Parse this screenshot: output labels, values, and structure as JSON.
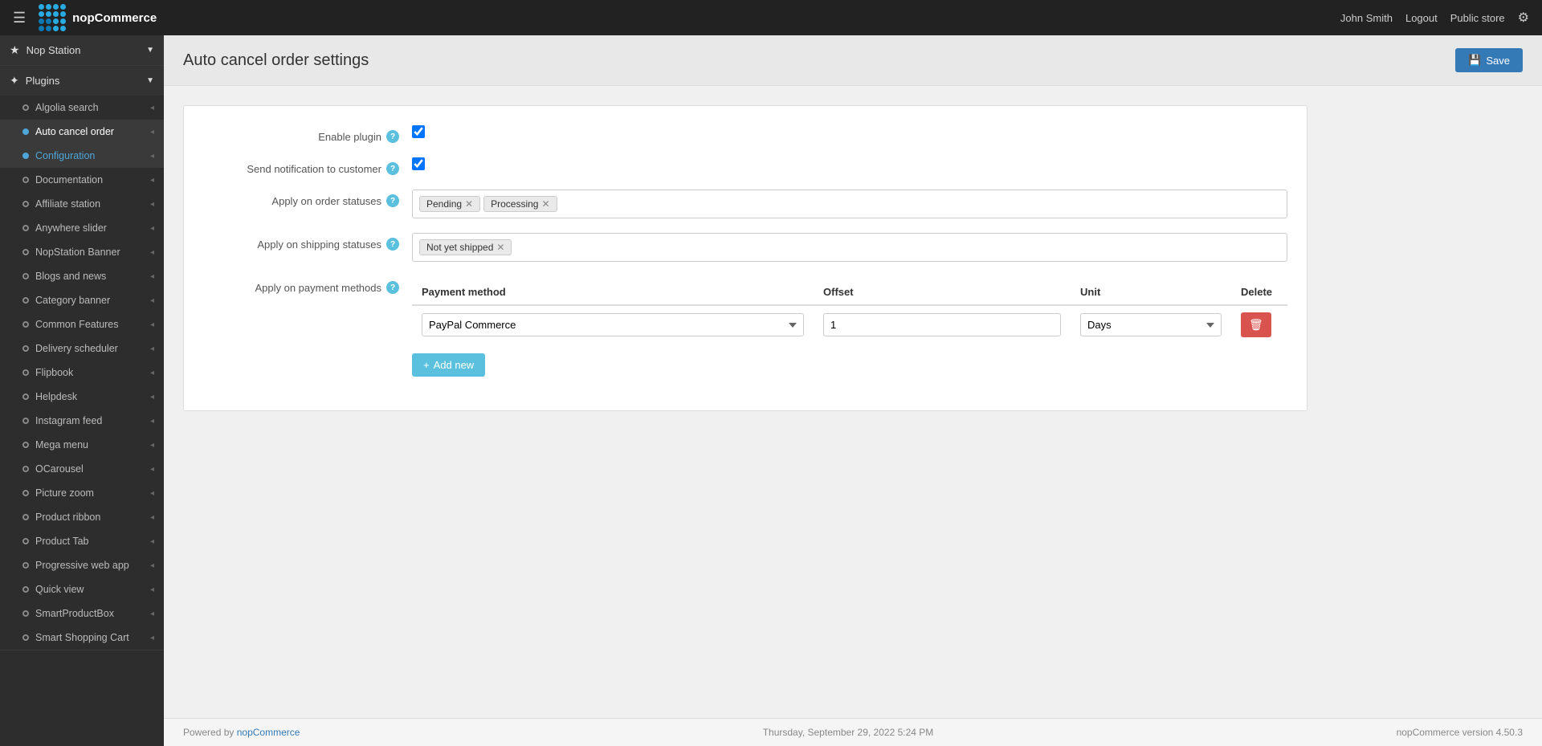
{
  "topnav": {
    "brand": "nopCommerce",
    "hamburger_label": "☰",
    "user": "John Smith",
    "logout_label": "Logout",
    "public_store_label": "Public store",
    "gear_label": "⚙"
  },
  "sidebar": {
    "nop_station_label": "Nop Station",
    "plugins_label": "Plugins",
    "items": [
      {
        "id": "algolia-search",
        "label": "Algolia search",
        "active": false
      },
      {
        "id": "auto-cancel-order",
        "label": "Auto cancel order",
        "active": true
      },
      {
        "id": "configuration",
        "label": "Configuration",
        "active": true,
        "sub": true
      },
      {
        "id": "documentation",
        "label": "Documentation",
        "active": false
      },
      {
        "id": "affiliate-station",
        "label": "Affiliate station",
        "active": false
      },
      {
        "id": "anywhere-slider",
        "label": "Anywhere slider",
        "active": false
      },
      {
        "id": "nopstation-banner",
        "label": "NopStation Banner",
        "active": false
      },
      {
        "id": "blogs-and-news",
        "label": "Blogs and news",
        "active": false
      },
      {
        "id": "category-banner",
        "label": "Category banner",
        "active": false
      },
      {
        "id": "common-features",
        "label": "Common Features",
        "active": false
      },
      {
        "id": "delivery-scheduler",
        "label": "Delivery scheduler",
        "active": false
      },
      {
        "id": "flipbook",
        "label": "Flipbook",
        "active": false
      },
      {
        "id": "helpdesk",
        "label": "Helpdesk",
        "active": false
      },
      {
        "id": "instagram-feed",
        "label": "Instagram feed",
        "active": false
      },
      {
        "id": "mega-menu",
        "label": "Mega menu",
        "active": false
      },
      {
        "id": "ocarousel",
        "label": "OCarousel",
        "active": false
      },
      {
        "id": "picture-zoom",
        "label": "Picture zoom",
        "active": false
      },
      {
        "id": "product-ribbon",
        "label": "Product ribbon",
        "active": false
      },
      {
        "id": "product-tab",
        "label": "Product Tab",
        "active": false
      },
      {
        "id": "progressive-web-app",
        "label": "Progressive web app",
        "active": false
      },
      {
        "id": "quick-view",
        "label": "Quick view",
        "active": false
      },
      {
        "id": "smartproductbox",
        "label": "SmartProductBox",
        "active": false
      },
      {
        "id": "smart-shopping-cart",
        "label": "Smart Shopping Cart",
        "active": false
      }
    ]
  },
  "page": {
    "title": "Auto cancel order settings",
    "save_button": "Save"
  },
  "form": {
    "enable_plugin_label": "Enable plugin",
    "enable_plugin_checked": true,
    "send_notification_label": "Send notification to customer",
    "send_notification_checked": true,
    "order_statuses_label": "Apply on order statuses",
    "order_statuses": [
      "Pending",
      "Processing"
    ],
    "shipping_statuses_label": "Apply on shipping statuses",
    "shipping_statuses": [
      "Not yet shipped"
    ],
    "payment_methods_label": "Apply on payment methods",
    "table": {
      "headers": [
        "Payment method",
        "Offset",
        "Unit",
        "Delete"
      ],
      "rows": [
        {
          "payment_method": "PayPal Commerce",
          "offset": "1",
          "unit": "Days"
        }
      ]
    },
    "add_new_label": "+ Add new"
  },
  "footer": {
    "powered_by": "Powered by",
    "powered_link": "nopCommerce",
    "datetime": "Thursday, September 29, 2022 5:24 PM",
    "version": "nopCommerce version 4.50.3"
  },
  "logo_dots": [
    "#29abe2",
    "#29abe2",
    "#29abe2",
    "#29abe2",
    "#29abe2",
    "#29abe2",
    "#29abe2",
    "#29abe2",
    "#0d7ab5",
    "#0d7ab5",
    "#29abe2",
    "#29abe2",
    "#0d7ab5",
    "#0d7ab5",
    "#29abe2",
    "#29abe2"
  ]
}
